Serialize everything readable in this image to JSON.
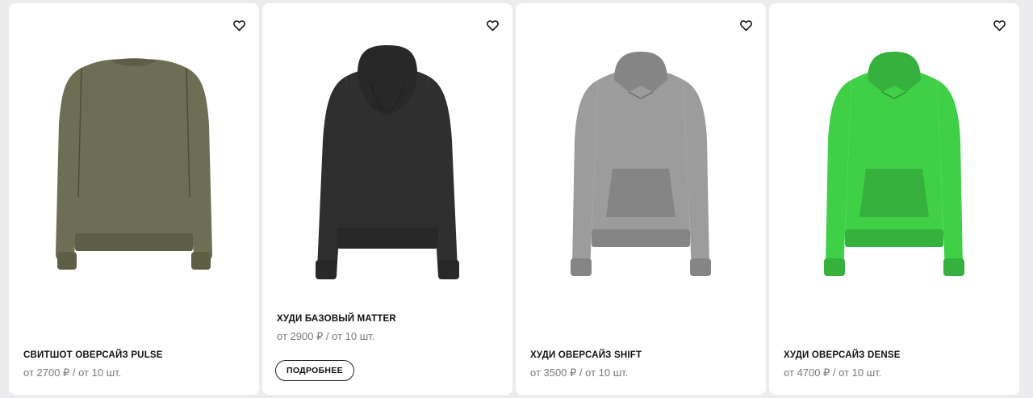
{
  "products": [
    {
      "name": "СВИТШОТ ОВЕРСАЙЗ PULSE",
      "price": "от 2700 ₽ / от 10 шт.",
      "color": "#6e6e54",
      "favorite_icon": "heart-outline-icon"
    },
    {
      "name": "ХУДИ БАЗОВЫЙ MATTER",
      "price": "от 2900 ₽ / от 10 шт.",
      "color": "#2f2f30",
      "button": "ПОДРОБНЕЕ",
      "favorite_icon": "heart-outline-icon"
    },
    {
      "name": "ХУДИ ОВЕРСАЙЗ SHIFT",
      "price": "от 3500 ₽ / от 10 шт.",
      "color": "#9b9c9b",
      "favorite_icon": "heart-outline-icon"
    },
    {
      "name": "ХУДИ ОВЕРСАЙЗ DENSE",
      "price": "от 4700 ₽ / от 10 шт.",
      "color": "#3fd048",
      "favorite_icon": "heart-outline-icon"
    }
  ]
}
